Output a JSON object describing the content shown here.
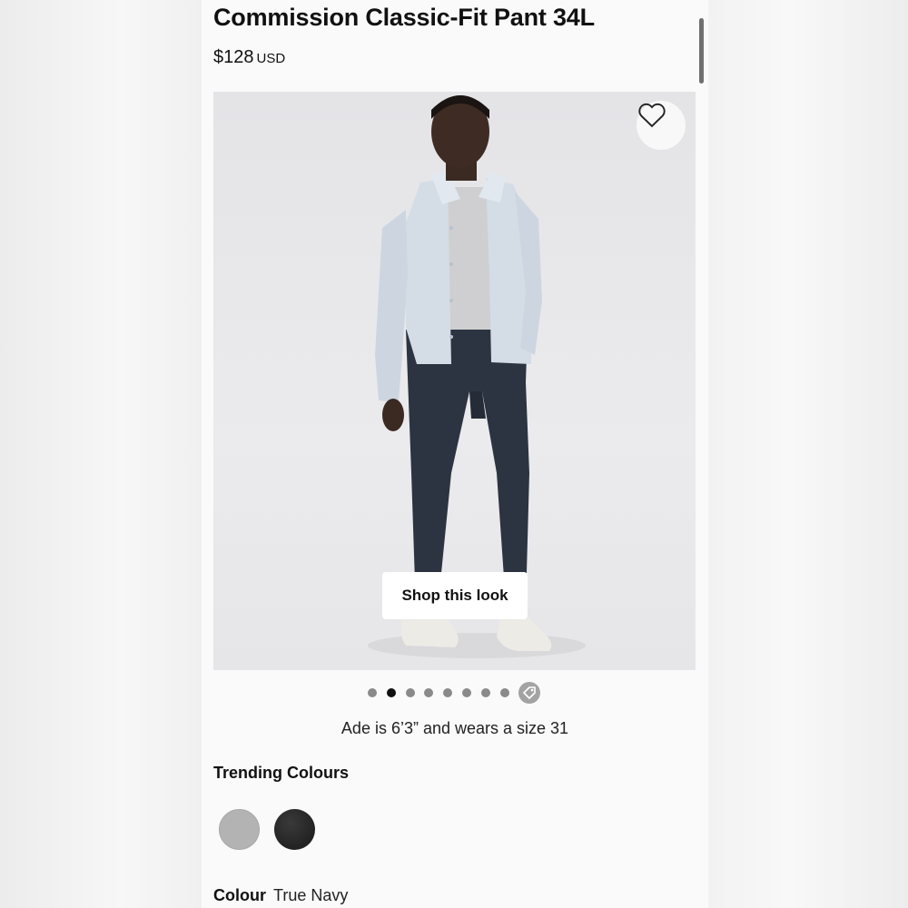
{
  "product": {
    "title": "Commission Classic-Fit Pant 34L",
    "price_amount": "$128",
    "price_currency": "USD"
  },
  "gallery": {
    "shop_look_label": "Shop this look",
    "dot_count": 8,
    "active_dot_index": 1,
    "favorite_icon": "heart-icon",
    "tag_icon": "tag-icon"
  },
  "model_info": "Ade is 6’3” and wears a size 31",
  "trending": {
    "label": "Trending Colours",
    "swatches": [
      {
        "name": "grey",
        "color": "#b3b3b3"
      },
      {
        "name": "black",
        "color": "#2a2a2a"
      }
    ]
  },
  "colour": {
    "label": "Colour",
    "value": "True Navy"
  }
}
